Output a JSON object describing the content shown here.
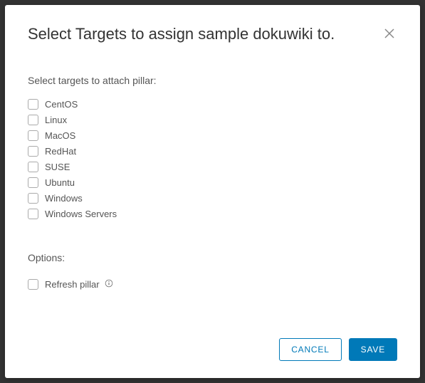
{
  "modal": {
    "title": "Select Targets to assign sample dokuwiki to.",
    "targets_label": "Select targets to attach pillar:",
    "targets": [
      {
        "label": "CentOS"
      },
      {
        "label": "Linux"
      },
      {
        "label": "MacOS"
      },
      {
        "label": "RedHat"
      },
      {
        "label": "SUSE"
      },
      {
        "label": "Ubuntu"
      },
      {
        "label": "Windows"
      },
      {
        "label": "Windows Servers"
      }
    ],
    "options_label": "Options:",
    "refresh_label": "Refresh pillar",
    "cancel_label": "CANCEL",
    "save_label": "SAVE"
  },
  "colors": {
    "primary": "#0079b8"
  }
}
